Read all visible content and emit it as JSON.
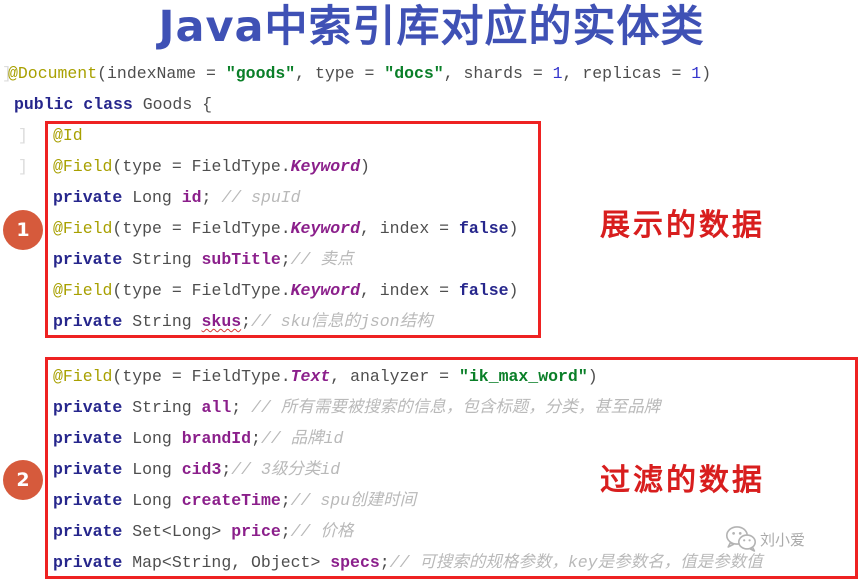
{
  "slide": {
    "title": "Java中索引库对应的实体类",
    "title_color": "#3f51b5"
  },
  "code": {
    "ghost_margin_chars": [
      "]",
      "]",
      "]"
    ],
    "lines": [
      {
        "id": "line-document",
        "tokens": [
          {
            "t": "@Document",
            "c": "anno"
          },
          {
            "t": "(indexName = ",
            "c": "plain"
          },
          {
            "t": "\"goods\"",
            "c": "str"
          },
          {
            "t": ", type = ",
            "c": "plain"
          },
          {
            "t": "\"docs\"",
            "c": "str"
          },
          {
            "t": ", shards = ",
            "c": "plain"
          },
          {
            "t": "1",
            "c": "num"
          },
          {
            "t": ", replicas = ",
            "c": "plain"
          },
          {
            "t": "1",
            "c": "num"
          },
          {
            "t": ")",
            "c": "plain"
          }
        ]
      },
      {
        "id": "line-class",
        "tokens": [
          {
            "t": "public class",
            "c": "kw"
          },
          {
            "t": " Goods {",
            "c": "type"
          }
        ]
      },
      {
        "id": "line-id-anno",
        "tokens": [
          {
            "t": "@Id",
            "c": "anno"
          }
        ]
      },
      {
        "id": "line-field-id",
        "tokens": [
          {
            "t": "@Field",
            "c": "anno"
          },
          {
            "t": "(type = FieldType.",
            "c": "plain"
          },
          {
            "t": "Keyword",
            "c": "enum"
          },
          {
            "t": ")",
            "c": "plain"
          }
        ]
      },
      {
        "id": "line-prop-id",
        "tokens": [
          {
            "t": "private",
            "c": "kw"
          },
          {
            "t": " Long ",
            "c": "type"
          },
          {
            "t": "id",
            "c": "field"
          },
          {
            "t": "; ",
            "c": "plain"
          },
          {
            "t": "// spuId",
            "c": "comment"
          }
        ]
      },
      {
        "id": "line-field-subtitle",
        "tokens": [
          {
            "t": "@Field",
            "c": "anno"
          },
          {
            "t": "(type = FieldType.",
            "c": "plain"
          },
          {
            "t": "Keyword",
            "c": "enum"
          },
          {
            "t": ", index = ",
            "c": "plain"
          },
          {
            "t": "false",
            "c": "bool"
          },
          {
            "t": ")",
            "c": "plain"
          }
        ]
      },
      {
        "id": "line-prop-subtitle",
        "tokens": [
          {
            "t": "private",
            "c": "kw"
          },
          {
            "t": " String ",
            "c": "type"
          },
          {
            "t": "subTitle",
            "c": "field"
          },
          {
            "t": ";",
            "c": "plain"
          },
          {
            "t": "// 卖点",
            "c": "comment"
          }
        ]
      },
      {
        "id": "line-field-skus",
        "tokens": [
          {
            "t": "@Field",
            "c": "anno"
          },
          {
            "t": "(type = FieldType.",
            "c": "plain"
          },
          {
            "t": "Keyword",
            "c": "enum"
          },
          {
            "t": ", index = ",
            "c": "plain"
          },
          {
            "t": "false",
            "c": "bool"
          },
          {
            "t": ")",
            "c": "plain"
          }
        ]
      },
      {
        "id": "line-prop-skus",
        "tokens": [
          {
            "t": "private",
            "c": "kw"
          },
          {
            "t": " String ",
            "c": "type"
          },
          {
            "t": "skus",
            "c": "field squig"
          },
          {
            "t": ";",
            "c": "plain"
          },
          {
            "t": "// sku信息的json结构",
            "c": "comment"
          }
        ]
      },
      {
        "id": "line-field-all",
        "tokens": [
          {
            "t": "@Field",
            "c": "anno"
          },
          {
            "t": "(type = FieldType.",
            "c": "plain"
          },
          {
            "t": "Text",
            "c": "enum"
          },
          {
            "t": ", analyzer = ",
            "c": "plain"
          },
          {
            "t": "\"ik_max_word\"",
            "c": "str"
          },
          {
            "t": ")",
            "c": "plain"
          }
        ]
      },
      {
        "id": "line-prop-all",
        "tokens": [
          {
            "t": "private",
            "c": "kw"
          },
          {
            "t": " String ",
            "c": "type"
          },
          {
            "t": "all",
            "c": "field"
          },
          {
            "t": "; ",
            "c": "plain"
          },
          {
            "t": "// 所有需要被搜索的信息，包含标题，分类，甚至品牌",
            "c": "comment"
          }
        ]
      },
      {
        "id": "line-prop-brandid",
        "tokens": [
          {
            "t": "private",
            "c": "kw"
          },
          {
            "t": " Long ",
            "c": "type"
          },
          {
            "t": "brandId",
            "c": "field"
          },
          {
            "t": ";",
            "c": "plain"
          },
          {
            "t": "// 品牌id",
            "c": "comment"
          }
        ]
      },
      {
        "id": "line-prop-cid3",
        "tokens": [
          {
            "t": "private",
            "c": "kw"
          },
          {
            "t": " Long ",
            "c": "type"
          },
          {
            "t": "cid3",
            "c": "field"
          },
          {
            "t": ";",
            "c": "plain"
          },
          {
            "t": "// 3级分类id",
            "c": "comment"
          }
        ]
      },
      {
        "id": "line-prop-createtime",
        "tokens": [
          {
            "t": "private",
            "c": "kw"
          },
          {
            "t": " Long ",
            "c": "type"
          },
          {
            "t": "createTime",
            "c": "field"
          },
          {
            "t": ";",
            "c": "plain"
          },
          {
            "t": "// spu创建时间",
            "c": "comment"
          }
        ]
      },
      {
        "id": "line-prop-price",
        "tokens": [
          {
            "t": "private",
            "c": "kw"
          },
          {
            "t": " Set<Long> ",
            "c": "type"
          },
          {
            "t": "price",
            "c": "field"
          },
          {
            "t": ";",
            "c": "plain"
          },
          {
            "t": "// 价格",
            "c": "comment"
          }
        ]
      },
      {
        "id": "line-prop-specs",
        "tokens": [
          {
            "t": "private",
            "c": "kw"
          },
          {
            "t": " Map<String, Object> ",
            "c": "type"
          },
          {
            "t": "specs",
            "c": "field"
          },
          {
            "t": ";",
            "c": "plain"
          },
          {
            "t": "// 可搜索的规格参数，key是参数名，值是参数值",
            "c": "comment"
          }
        ]
      }
    ]
  },
  "highlights": {
    "box_color": "#ee2222",
    "boxes": [
      {
        "id": "hl-box-1",
        "label": "display-data-box"
      },
      {
        "id": "hl-box-2",
        "label": "filter-data-box"
      }
    ]
  },
  "badges": [
    {
      "id": "badge-1",
      "label": "1",
      "color": "#d65a3c"
    },
    {
      "id": "badge-2",
      "label": "2",
      "color": "#d65a3c"
    }
  ],
  "annotations": [
    {
      "id": "annotation-1",
      "text": "展示的数据",
      "color": "#d81e1e"
    },
    {
      "id": "annotation-2",
      "text": "过滤的数据",
      "color": "#d81e1e"
    }
  ],
  "watermark": {
    "icon": "wechat-icon",
    "name": "刘小爱"
  }
}
